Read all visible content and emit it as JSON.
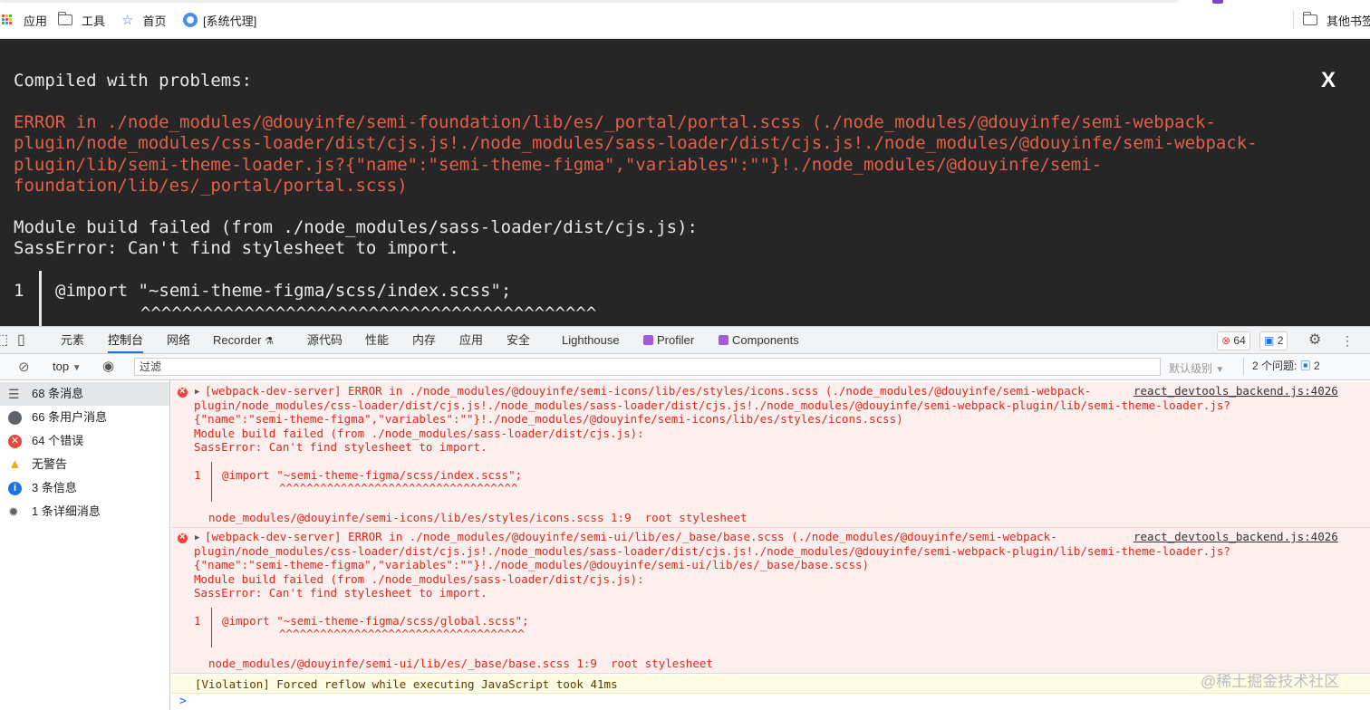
{
  "bookmarks": {
    "items": [
      {
        "label": "应用",
        "icon": "apps-grid-icon"
      },
      {
        "label": "工具",
        "icon": "folder-icon"
      },
      {
        "label": "首页",
        "icon": "star-icon"
      },
      {
        "label": "[系统代理]",
        "icon": "globe-icon"
      }
    ],
    "other": {
      "label": "其他书签",
      "icon": "folder-icon"
    }
  },
  "overlay": {
    "title": "Compiled with problems:",
    "close": "X",
    "error_lines": [
      "ERROR in ./node_modules/@douyinfe/semi-foundation/lib/es/_portal/portal.scss (./node_modules/@douyinfe/semi-webpack-",
      "plugin/node_modules/css-loader/dist/cjs.js!./node_modules/sass-loader/dist/cjs.js!./node_modules/@douyinfe/semi-webpack-",
      "plugin/lib/semi-theme-loader.js?{\"name\":\"semi-theme-figma\",\"variables\":\"\"}!./node_modules/@douyinfe/semi-",
      "foundation/lib/es/_portal/portal.scss)"
    ],
    "message_lines": [
      "Module build failed (from ./node_modules/sass-loader/dist/cjs.js):",
      "SassError: Can't find stylesheet to import."
    ],
    "code_line_number": "1",
    "code_text": "@import \"~semi-theme-figma/scss/index.scss\";",
    "carets": "^^^^^^^^^^^^^^^^^^^^^^^^^^^^^^^^^^^^^^^^^^^^"
  },
  "devtools": {
    "tabs": [
      "元素",
      "控制台",
      "网络",
      "Recorder",
      "源代码",
      "性能",
      "内存",
      "应用",
      "安全",
      "Lighthouse",
      "Profiler",
      "Components"
    ],
    "active_tab": "控制台",
    "error_count": "64",
    "issue_count": "2",
    "toolbar": {
      "context": "top",
      "filter_placeholder": "过滤",
      "levels": "默认级别",
      "issues_label": "2 个问题:",
      "issues_count": "2"
    },
    "sidebar": [
      {
        "label": "68 条消息",
        "icon": "list-icon"
      },
      {
        "label": "66 条用户消息",
        "icon": "user-icon"
      },
      {
        "label": "64 个错误",
        "icon": "error-icon"
      },
      {
        "label": "无警告",
        "icon": "warning-icon"
      },
      {
        "label": "3 条信息",
        "icon": "info-icon"
      },
      {
        "label": "1 条详细消息",
        "icon": "bug-icon"
      }
    ],
    "messages": [
      {
        "source": "react_devtools_backend.js:4026",
        "lines": [
          "[webpack-dev-server] ERROR in ./node_modules/@douyinfe/semi-icons/lib/es/styles/icons.scss (./node_modules/@douyinfe/semi-webpack-",
          "plugin/node_modules/css-loader/dist/cjs.js!./node_modules/sass-loader/dist/cjs.js!./node_modules/@douyinfe/semi-webpack-plugin/lib/semi-theme-loader.js?",
          "{\"name\":\"semi-theme-figma\",\"variables\":\"\"}!./node_modules/@douyinfe/semi-icons/lib/es/styles/icons.scss)",
          "Module build failed (from ./node_modules/sass-loader/dist/cjs.js):",
          "SassError: Can't find stylesheet to import."
        ],
        "code_num": "1",
        "code": "@import \"~semi-theme-figma/scss/index.scss\";",
        "carets": "^^^^^^^^^^^^^^^^^^^^^^^^^^^^^^^^^^^",
        "footer": "node_modules/@douyinfe/semi-icons/lib/es/styles/icons.scss 1:9  root stylesheet"
      },
      {
        "source": "react_devtools_backend.js:4026",
        "lines": [
          "[webpack-dev-server] ERROR in ./node_modules/@douyinfe/semi-ui/lib/es/_base/base.scss (./node_modules/@douyinfe/semi-webpack-",
          "plugin/node_modules/css-loader/dist/cjs.js!./node_modules/sass-loader/dist/cjs.js!./node_modules/@douyinfe/semi-webpack-plugin/lib/semi-theme-loader.js?",
          "{\"name\":\"semi-theme-figma\",\"variables\":\"\"}!./node_modules/@douyinfe/semi-ui/lib/es/_base/base.scss)",
          "Module build failed (from ./node_modules/sass-loader/dist/cjs.js):",
          "SassError: Can't find stylesheet to import."
        ],
        "code_num": "1",
        "code": "@import \"~semi-theme-figma/scss/global.scss\";",
        "carets": "^^^^^^^^^^^^^^^^^^^^^^^^^^^^^^^^^^^^",
        "footer": "node_modules/@douyinfe/semi-ui/lib/es/_base/base.scss 1:9  root stylesheet"
      }
    ],
    "violation": "[Violation] Forced reflow while executing JavaScript took 41ms",
    "prompt": ">"
  },
  "watermark": "@稀土掘金技术社区",
  "colors": {
    "overlay_bg": "#262626",
    "overlay_error": "#e36049",
    "console_error_bg": "#fcefee",
    "console_error_text": "#e0281b",
    "accent": "#1a73e8"
  }
}
